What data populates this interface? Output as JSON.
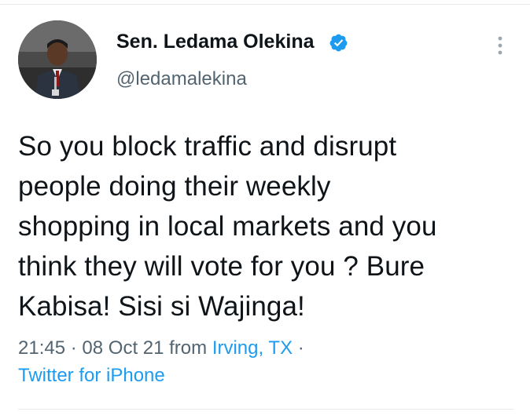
{
  "author": {
    "display_name": "Sen. Ledama Olekina",
    "handle": "@ledamalekina",
    "verified_icon": "verified-badge-icon",
    "avatar": "profile-photo"
  },
  "menu_icon": "more-vertical-icon",
  "tweet": {
    "text": "So you block traffic and disrupt\npeople doing their weekly\nshopping in local markets and you\nthink they will vote for you ? Bure\nKabisa! Sisi si Wajinga!",
    "time": "21:45",
    "separator": "·",
    "date": "08 Oct 21",
    "from_label": "from",
    "location": "Irving, TX",
    "trailing_separator": "·",
    "source": "Twitter for iPhone"
  },
  "colors": {
    "text": "#0f1419",
    "secondary": "#536471",
    "link": "#1d9bf0",
    "verified": "#1d9bf0",
    "divider": "#e6ecf0"
  }
}
